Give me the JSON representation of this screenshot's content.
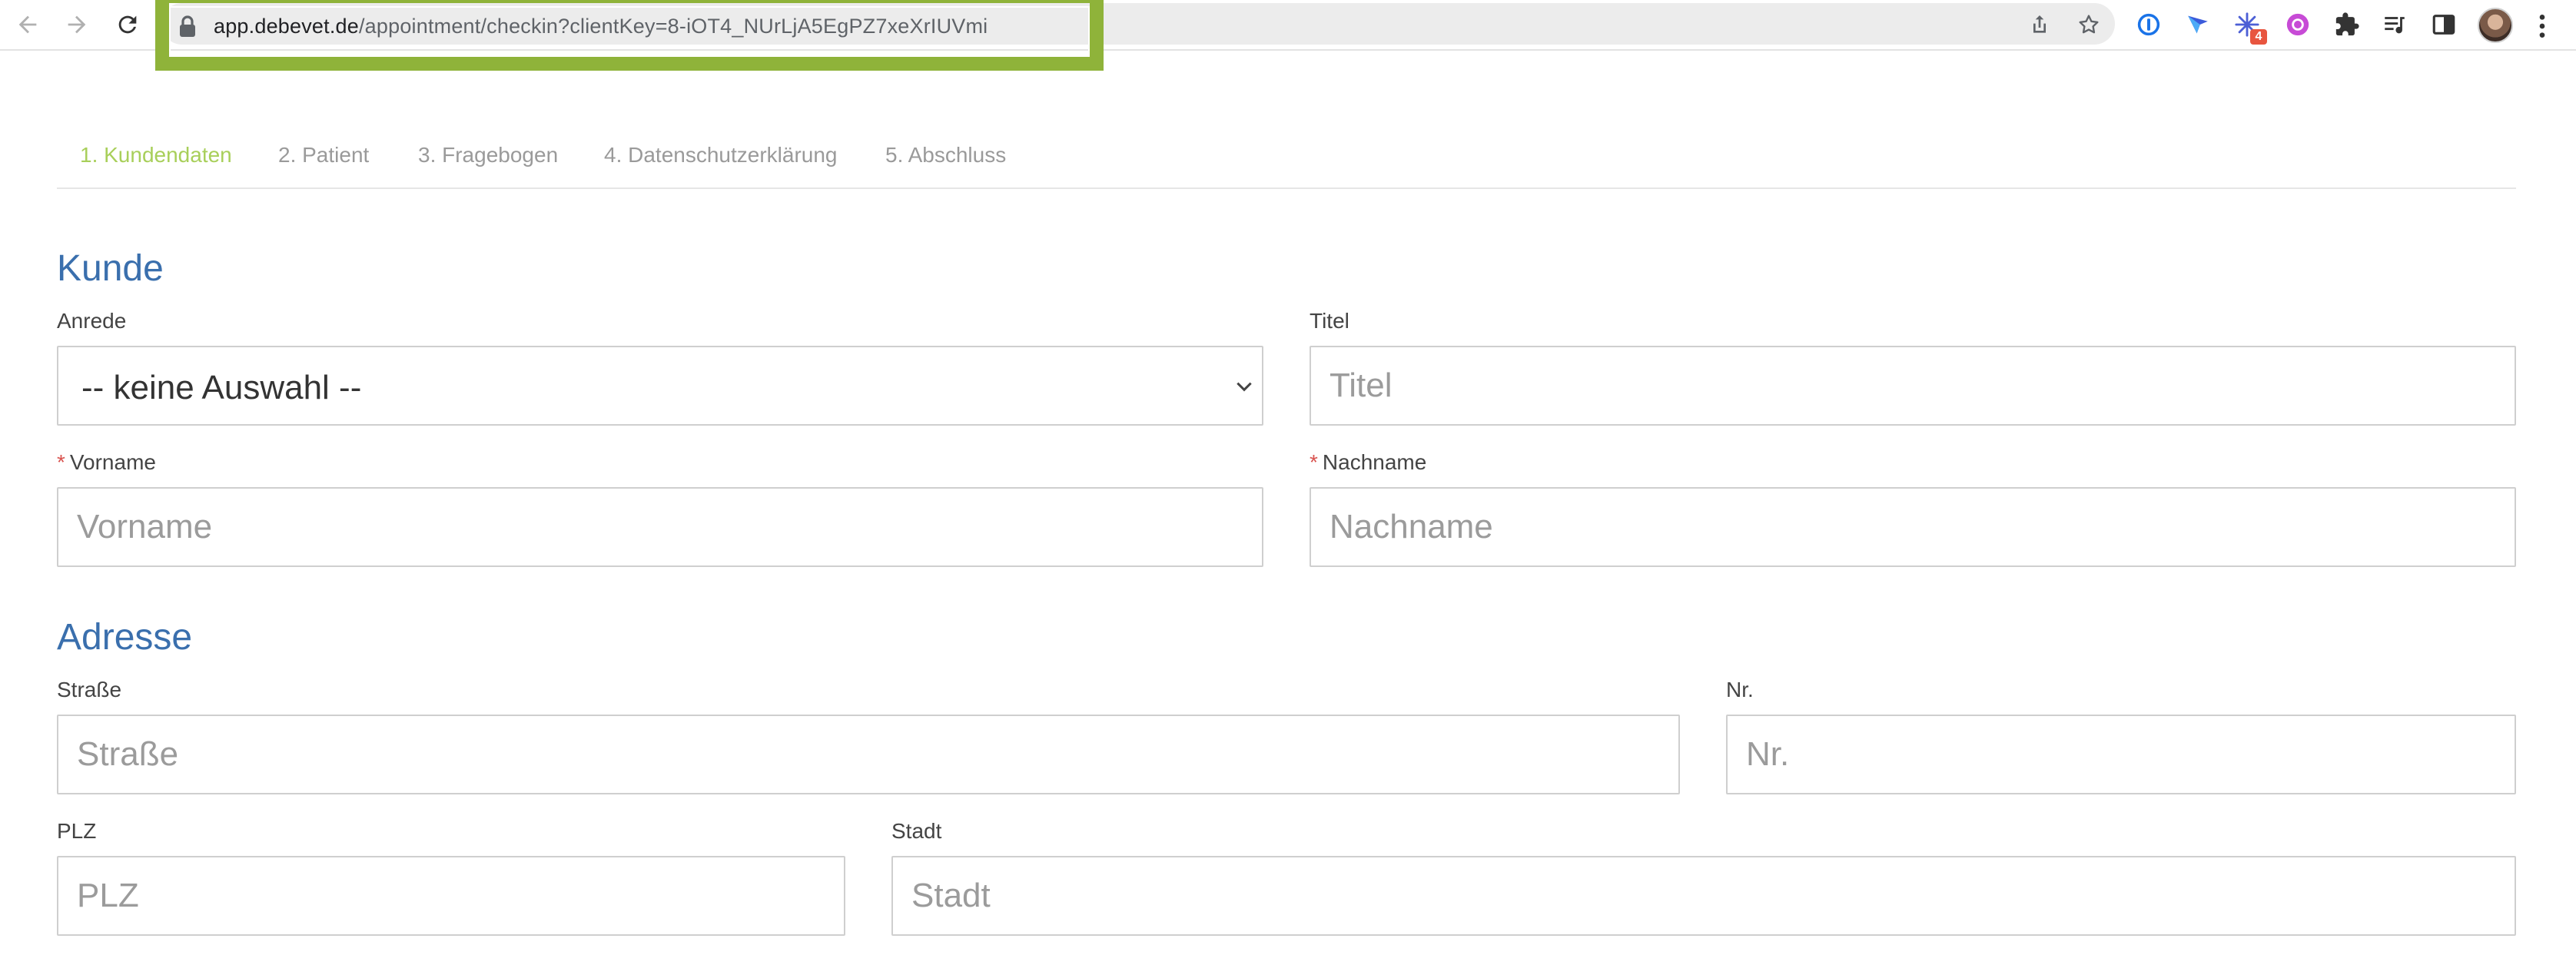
{
  "browser": {
    "url_host": "app.debevet.de",
    "url_path": "/appointment/checkin?clientKey=8-iOT4_NUrLjA5EgPZ7xeXrIUVmi",
    "highlight_color": "#8fb33a",
    "extension_badge": "4",
    "icons": [
      "back-icon",
      "forward-icon",
      "reload-icon",
      "lock-icon",
      "share-icon",
      "bookmark-star-icon",
      "password-manager-icon",
      "arrow-extension-icon",
      "snowflake-extension-icon",
      "circle-extension-icon",
      "puzzle-extensions-icon",
      "media-control-icon",
      "side-panel-icon",
      "profile-avatar",
      "menu-icon"
    ]
  },
  "steps": [
    {
      "label": "1. Kundendaten",
      "active": true
    },
    {
      "label": "2. Patient",
      "active": false
    },
    {
      "label": "3. Fragebogen",
      "active": false
    },
    {
      "label": "4. Datenschutzerklärung",
      "active": false
    },
    {
      "label": "5. Abschluss",
      "active": false
    }
  ],
  "colors": {
    "step_active": "#a8cf5a",
    "step_inactive": "#9a9a9a",
    "section_title": "#3a6fad",
    "required": "#d9534f"
  },
  "kunde": {
    "title": "Kunde",
    "anrede": {
      "label": "Anrede",
      "value": "-- keine Auswahl --"
    },
    "titel": {
      "label": "Titel",
      "placeholder": "Titel",
      "value": ""
    },
    "vorname": {
      "required_mark": "*",
      "label": "Vorname",
      "placeholder": "Vorname",
      "value": ""
    },
    "nachname": {
      "required_mark": "*",
      "label": "Nachname",
      "placeholder": "Nachname",
      "value": ""
    }
  },
  "adresse": {
    "title": "Adresse",
    "strasse": {
      "label": "Straße",
      "placeholder": "Straße",
      "value": ""
    },
    "nr": {
      "label": "Nr.",
      "placeholder": "Nr.",
      "value": ""
    },
    "plz": {
      "label": "PLZ",
      "placeholder": "PLZ",
      "value": ""
    },
    "stadt": {
      "label": "Stadt",
      "placeholder": "Stadt",
      "value": ""
    }
  }
}
